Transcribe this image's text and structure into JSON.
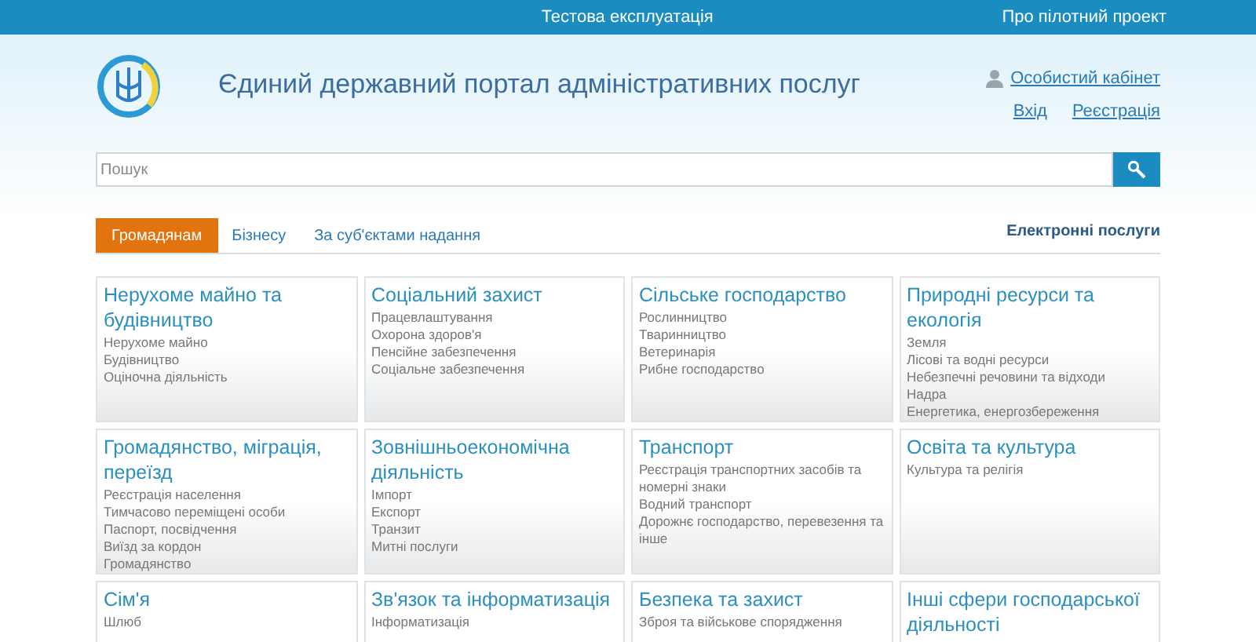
{
  "top_bar": {
    "center_link": "Тестова експлуатація",
    "right_link": "Про пілотний проект"
  },
  "header": {
    "title": "Єдиний державний портал адміністративних послуг",
    "account_link": "Особистий кабінет",
    "login_link": "Вхід",
    "register_link": "Реєстрація"
  },
  "search": {
    "placeholder": "Пошук"
  },
  "tabs": [
    {
      "label": "Громадянам",
      "selected": true
    },
    {
      "label": "Бізнесу",
      "selected": false
    },
    {
      "label": "За суб'єктами надання",
      "selected": false
    }
  ],
  "electronic_services_link": "Електронні послуги",
  "categories": [
    {
      "title": "Нерухоме майно та будівництво",
      "items": [
        "Нерухоме майно",
        "Будівництво",
        "Оціночна діяльність"
      ]
    },
    {
      "title": "Соціальний захист",
      "items": [
        "Працевлаштування",
        "Охорона здоров'я",
        "Пенсійне забезпечення",
        "Соціальне забезпечення"
      ]
    },
    {
      "title": "Сільське господарство",
      "items": [
        "Рослинництво",
        "Тваринництво",
        "Ветеринарія",
        "Рибне господарство"
      ]
    },
    {
      "title": "Природні ресурси та екологія",
      "items": [
        "Земля",
        "Лісові та водні ресурси",
        "Небезпечні речовини та відходи",
        "Надра",
        "Енергетика, енергозбереження"
      ]
    },
    {
      "title": "Громадянство, міграція, переїзд",
      "items": [
        "Реєстрація населення",
        "Тимчасово переміщені особи",
        "Паспорт, посвідчення",
        "Виїзд за кордон",
        "Громадянство"
      ]
    },
    {
      "title": "Зовнішньоекономічна діяльність",
      "items": [
        "Імпорт",
        "Експорт",
        "Транзит",
        "Митні послуги"
      ]
    },
    {
      "title": "Транспорт",
      "items": [
        "Реєстрація транспортних засобів та номерні знаки",
        "Водний транспорт",
        "Дорожнє господарство, перевезення та інше"
      ]
    },
    {
      "title": "Освіта та культура",
      "items": [
        "Культура та релігія"
      ]
    },
    {
      "title": "Сім'я",
      "items": [
        "Шлюб"
      ]
    },
    {
      "title": "Зв'язок та інформатизація",
      "items": [
        "Інформатизація"
      ]
    },
    {
      "title": "Безпека та захист",
      "items": [
        "Зброя та військове спорядження"
      ]
    },
    {
      "title": "Інші сфери господарської діяльності"
    }
  ]
}
